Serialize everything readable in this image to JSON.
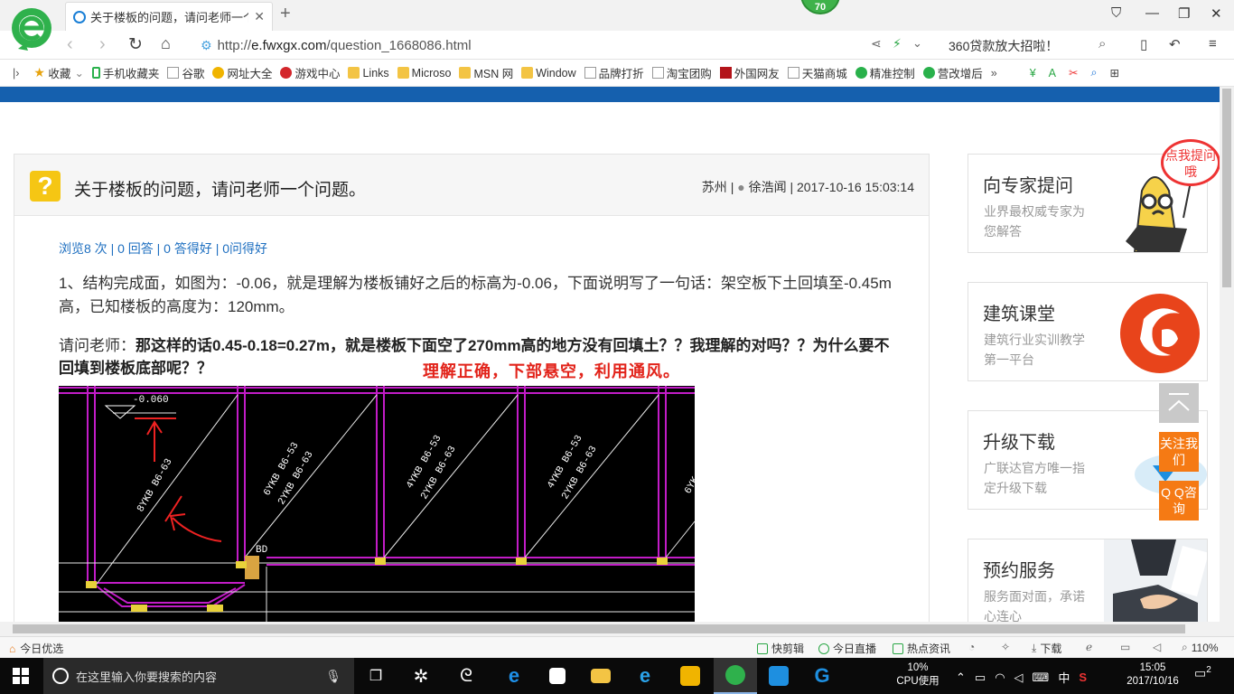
{
  "browser": {
    "tab_title": "关于楼板的问题，请问老师一个问",
    "badge": "70",
    "url_prefix": "http://",
    "url_domain": "e.fwxgx.com",
    "url_path": "/question_1668086.html",
    "search_text": "360贷款放大招啦！"
  },
  "bookmarks": [
    {
      "label": "收藏",
      "icon": "star-icon"
    },
    {
      "label": "手机收藏夹",
      "icon": "phone-icon"
    },
    {
      "label": "谷歌",
      "icon": "page-icon"
    },
    {
      "label": "网址大全",
      "icon": "site-icon"
    },
    {
      "label": "游戏中心",
      "icon": "game-icon"
    },
    {
      "label": "Links",
      "icon": "folder-icon"
    },
    {
      "label": "Microso",
      "icon": "folder-icon"
    },
    {
      "label": "MSN 网",
      "icon": "folder-icon"
    },
    {
      "label": "Window",
      "icon": "folder-icon"
    },
    {
      "label": "品牌打折",
      "icon": "page-icon"
    },
    {
      "label": "淘宝团购",
      "icon": "page-icon"
    },
    {
      "label": "外国网友",
      "icon": "bookmark-icon"
    },
    {
      "label": "天猫商城",
      "icon": "page-icon"
    },
    {
      "label": "精准控制",
      "icon": "wechat-icon"
    },
    {
      "label": "营改增后",
      "icon": "wechat-icon"
    }
  ],
  "question": {
    "icon_char": "?",
    "title": "关于楼板的问题，请问老师一个问题。",
    "meta": "苏州 | 徐浩闻 | 2017-10-16 15:03:14",
    "location": "苏州",
    "author": "徐浩闻",
    "datetime": "2017-10-16 15:03:14",
    "stats": "浏览8 次 | 0 回答 | 0 答得好 | 0问得好",
    "para1": "1、结构完成面，如图为：-0.06，就是理解为楼板铺好之后的标高为-0.06，下面说明写了一句话：架空板下土回填至-0.45m高，已知楼板的高度为：120mm。",
    "para2_lead": "请问老师：",
    "para2_bold": "那这样的话0.45-0.18=0.27m，就是楼板下面空了270mm高的地方没有回填土？？我理解的对吗？？为什么要不回填到楼板底部呢？？",
    "answer": "理解正确，下部悬空，利用通风。"
  },
  "drawing": {
    "elevation": "-0.060",
    "labels": [
      "8YKB  B6-63",
      "6YKB  B6-53",
      "2YKB  B6-63",
      "4YKB  B6-53",
      "2YKB  B6-63",
      "4YKB  B6-53",
      "2YKB  B6-63",
      "6YK"
    ],
    "bd_label": "BD"
  },
  "sidebar": [
    {
      "title": "向专家提问",
      "desc": "业界最权威专家为您解答"
    },
    {
      "title": "建筑课堂",
      "desc": "建筑行业实训教学第一平台"
    },
    {
      "title": "升级下载",
      "desc": "广联达官方唯一指定升级下载"
    },
    {
      "title": "预约服务",
      "desc": "服务面对面，承诺心连心"
    }
  ],
  "bubble": "点我提问哦",
  "float_buttons": {
    "follow": "关注我们",
    "qq": "Q Q咨询"
  },
  "statusbar": {
    "left": "今日优选",
    "items": [
      "快剪辑",
      "今日直播",
      "热点资讯",
      "下载"
    ],
    "zoom": "110%"
  },
  "taskbar": {
    "search_placeholder": "在这里输入你要搜索的内容",
    "cpu_value": "10%",
    "cpu_label": "CPU使用",
    "ime": "中",
    "time": "15:05",
    "date": "2017/10/16",
    "notif_count": "2"
  },
  "colors": {
    "accent_blue": "#1560ae",
    "answer_red": "#e2231a",
    "float_orange": "#f57a14",
    "icon_yellow": "#f5c614"
  }
}
